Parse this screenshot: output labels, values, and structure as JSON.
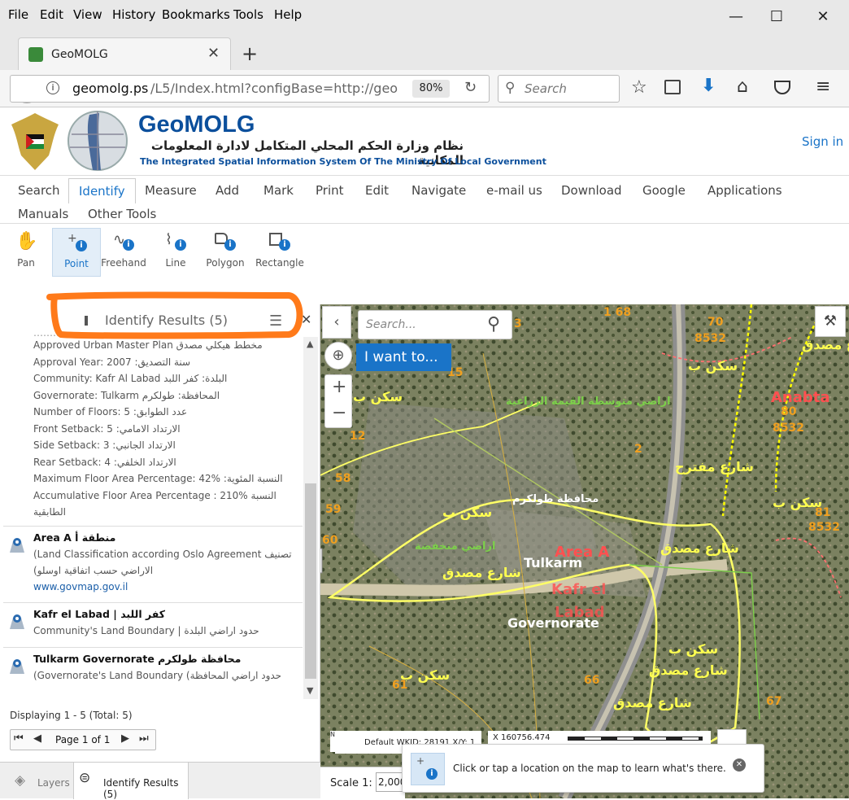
{
  "browser": {
    "menu": [
      "File",
      "Edit",
      "View",
      "History",
      "Bookmarks",
      "Tools",
      "Help"
    ],
    "tab_title": "GeoMOLG",
    "url_host": "geomolg.ps",
    "url_path": "/L5/Index.html?configBase=http://geo",
    "zoom": "80%",
    "search_placeholder": "Search"
  },
  "app": {
    "logo_title": "GeoMOLG",
    "arabic_subtitle": "نظام وزارة الحكم المحلي المتكامل لادارة المعلومات المكانية",
    "english_subtitle": "The Integrated Spatial Information System Of The Ministry Of Local Government",
    "sign_in": "Sign in",
    "menu_row1": [
      "Search",
      "Identify",
      "Measure",
      "Add",
      "Mark",
      "Print",
      "Edit",
      "Navigate",
      "e-mail us",
      "Download",
      "Google",
      "Applications"
    ],
    "menu_row2": [
      "Manuals",
      "Other Tools"
    ],
    "tools": [
      "Pan",
      "Point",
      "Freehand",
      "Line",
      "Polygon",
      "Rectangle"
    ]
  },
  "panel": {
    "title": "Identify Results (5)",
    "lines": [
      "Approved Urban Master Plan   مخطط هيكلي مصدق",
      "Approval Year: 2007  :سنة التصديق",
      "Community: Kafr Al Labad  البلدة: كفر اللبد",
      "Governorate: Tulkarm   المحافظة: طولكرم",
      "Number of Floors: 5  :عدد الطوابق",
      "Front Setback: 5  :الارتداد الامامي",
      "Side Setback: 3  :الارتداد الجانبي",
      "Rear Setback: 4  :الارتداد الخلفي",
      "Maximum Floor Area Percentage: 42%  :النسبة المئوية",
      "Accumulative Floor Area Percentage   : 210% النسبة",
      "الطابقية"
    ],
    "items": [
      {
        "title": "Area A منطقة أ",
        "sub1": "(Land Classification according Oslo Agreement   تصنيف",
        "sub2": "(الاراضي حسب اتفاقية اوسلو",
        "link": "www.govmap.gov.il"
      },
      {
        "title": "Kafr el Labad | كفر اللبد",
        "sub1": "Community's Land Boundary |  حدود اراضي البلدة"
      },
      {
        "title": "Tulkarm Governorate محافظة طولكرم",
        "sub1": "(Governorate's Land Boundary  (حدود اراضي المحافظة"
      }
    ],
    "displaying": "Displaying 1 - 5 (Total: 5)",
    "page_label": "Page 1 of 1",
    "bottom_tabs": [
      "Layers",
      "Identify Results (5)"
    ]
  },
  "map": {
    "search_placeholder": "Search...",
    "i_want_to": "I want to...",
    "tooltip": "Click or tap a location on the map to learn what's there.",
    "scale_label": "Scale 1:",
    "scale_value": "2,000",
    "coord_x": "X  160756.474",
    "projection": "Default WKID: 28191 X/Y: 1",
    "labels": {
      "anabta": "Anabta",
      "area_a": "Area A",
      "tulkarm": "Tulkarm",
      "kafr": "Kafr el",
      "labad": "Labad",
      "governorate": "Governorate"
    }
  },
  "colors": {
    "brand_blue": "#0b4f9c",
    "identify_blue": "#1a74c8",
    "highlight_orange": "#ff7a1a"
  }
}
